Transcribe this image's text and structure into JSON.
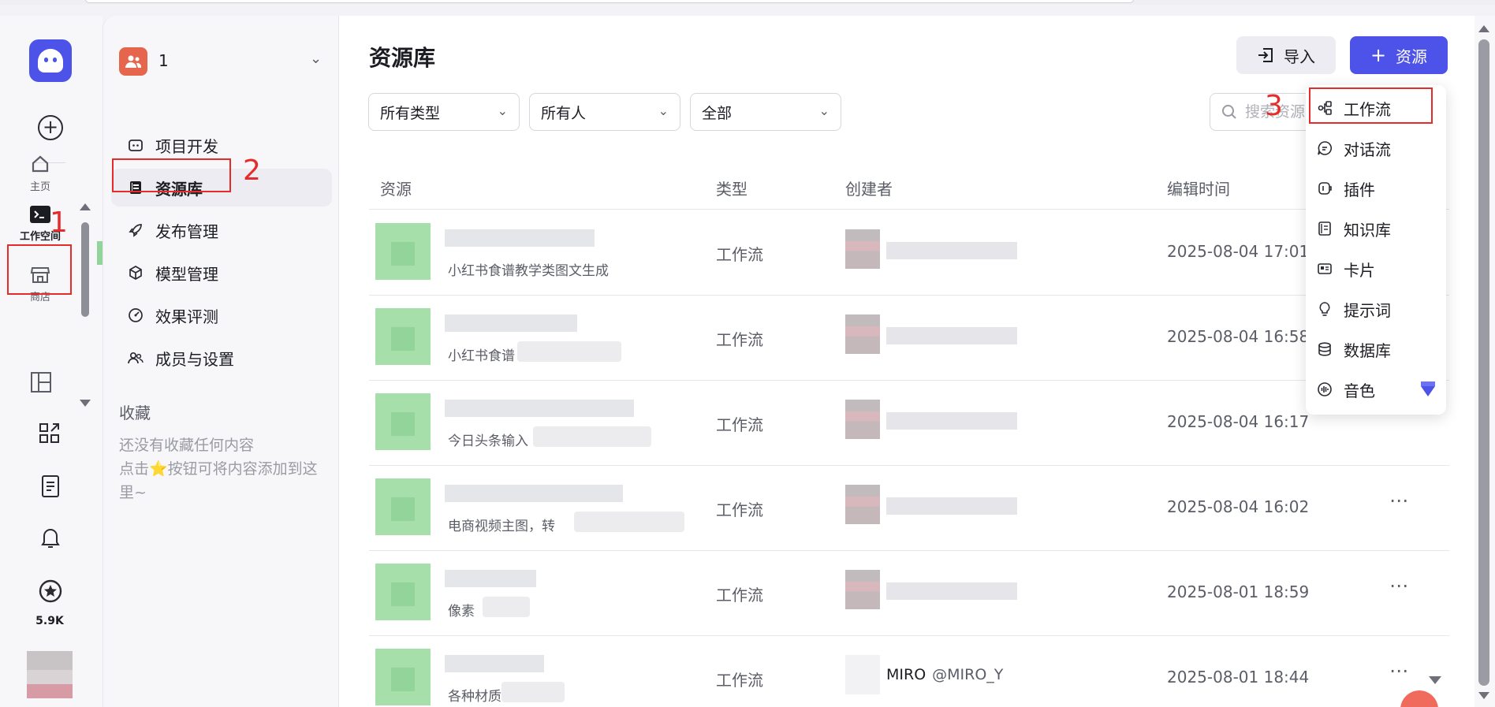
{
  "rail": {
    "items": [
      {
        "label": "主页",
        "icon": "home-icon"
      },
      {
        "label": "工作空间",
        "icon": "terminal-icon"
      },
      {
        "label": "商店",
        "icon": "store-icon"
      }
    ],
    "star_count": "5.9K"
  },
  "workspace": {
    "name": "1"
  },
  "nav": {
    "items": [
      {
        "label": "项目开发",
        "icon": "robot-icon"
      },
      {
        "label": "资源库",
        "icon": "library-icon"
      },
      {
        "label": "发布管理",
        "icon": "rocket-icon"
      },
      {
        "label": "模型管理",
        "icon": "cube-icon"
      },
      {
        "label": "效果评测",
        "icon": "gauge-icon"
      },
      {
        "label": "成员与设置",
        "icon": "users-icon"
      }
    ],
    "favorites_title": "收藏",
    "favorites_empty_1": "还没有收藏任何内容",
    "favorites_empty_2": "点击⭐按钮可将内容添加到这里~"
  },
  "main": {
    "title": "资源库",
    "import_label": "导入",
    "add_label": "资源",
    "filters": [
      "所有类型",
      "所有人",
      "全部"
    ],
    "search_placeholder": "搜索资源",
    "columns": [
      "资源",
      "类型",
      "创建者",
      "编辑时间"
    ],
    "rows": [
      {
        "desc": "小红书食谱教学类图文生成",
        "type": "工作流",
        "creator": "",
        "handle": "",
        "time": "2025-08-04 17:01"
      },
      {
        "desc": "小红书食谱",
        "type": "工作流",
        "creator": "",
        "handle": "",
        "time": "2025-08-04 16:58"
      },
      {
        "desc": "今日头条输入",
        "type": "工作流",
        "creator": "",
        "handle": "",
        "time": "2025-08-04 16:17"
      },
      {
        "desc": "电商视频主图，转",
        "type": "工作流",
        "creator": "",
        "handle": "",
        "time": "2025-08-04 16:02"
      },
      {
        "desc": "像素",
        "type": "工作流",
        "creator": "",
        "handle": "",
        "time": "2025-08-01 18:59"
      },
      {
        "desc": "各种材质",
        "type": "工作流",
        "creator": "MIRO",
        "handle": "@MIRO_Y",
        "time": "2025-08-01 18:44"
      }
    ]
  },
  "dropdown": {
    "items": [
      {
        "label": "工作流",
        "icon": "workflow-icon"
      },
      {
        "label": "对话流",
        "icon": "chatflow-icon"
      },
      {
        "label": "插件",
        "icon": "plugin-icon"
      },
      {
        "label": "知识库",
        "icon": "knowledge-icon"
      },
      {
        "label": "卡片",
        "icon": "card-icon"
      },
      {
        "label": "提示词",
        "icon": "bulb-icon"
      },
      {
        "label": "数据库",
        "icon": "database-icon"
      },
      {
        "label": "音色",
        "icon": "voice-icon"
      }
    ]
  },
  "annotations": [
    "1",
    "2",
    "3"
  ],
  "colors": {
    "accent": "#4d53e8",
    "annotation": "#e62b2b"
  }
}
